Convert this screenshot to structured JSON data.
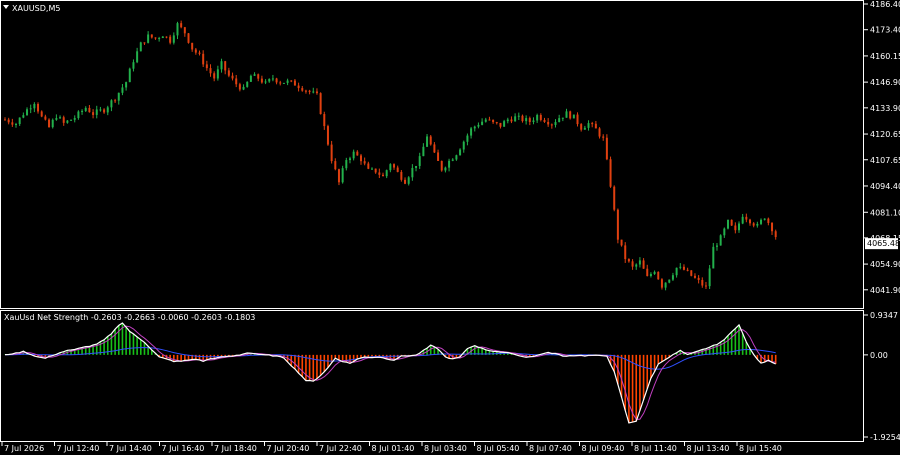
{
  "symbol_header": "XAUUSD,M5",
  "indicator_header": "XauUsd Net Strength -0.2603 -0.2663 -0.0060 -0.2603 -0.1803",
  "current_price": "4065.48",
  "colors": {
    "background": "#000000",
    "frame": "#ffffff",
    "bull": "#22b14c",
    "bear": "#e04010",
    "hist_pos": "#18c018",
    "hist_neg": "#ff4400",
    "line_main": "#ffffff",
    "line_signal": "#c040c0",
    "line_blue": "#3050ff"
  },
  "chart_data": [
    {
      "type": "candlestick",
      "y_axis_ticks": [
        "4186.40",
        "4173.40",
        "4160.15",
        "4146.90",
        "4133.90",
        "4120.65",
        "4107.65",
        "4094.40",
        "4081.10",
        "4068.15",
        "4054.90",
        "4041.90"
      ],
      "y_range": [
        4037.5,
        4186.4
      ],
      "close_path": [
        [
          0,
          4128
        ],
        [
          3,
          4126
        ],
        [
          5,
          4131
        ],
        [
          8,
          4137
        ],
        [
          10,
          4129
        ],
        [
          12,
          4124
        ],
        [
          14,
          4130
        ],
        [
          16,
          4126
        ],
        [
          19,
          4129
        ],
        [
          22,
          4134
        ],
        [
          24,
          4131
        ],
        [
          27,
          4133
        ],
        [
          30,
          4139
        ],
        [
          33,
          4147
        ],
        [
          35,
          4158
        ],
        [
          37,
          4166
        ],
        [
          39,
          4170
        ],
        [
          41,
          4169
        ],
        [
          43,
          4171
        ],
        [
          45,
          4168
        ],
        [
          47,
          4176
        ],
        [
          49,
          4172
        ],
        [
          51,
          4164
        ],
        [
          53,
          4160
        ],
        [
          55,
          4154
        ],
        [
          57,
          4149
        ],
        [
          59,
          4156
        ],
        [
          61,
          4150
        ],
        [
          63,
          4146
        ],
        [
          65,
          4143
        ],
        [
          67,
          4150
        ],
        [
          69,
          4149
        ],
        [
          71,
          4146
        ],
        [
          73,
          4149
        ],
        [
          75,
          4147
        ],
        [
          77,
          4147
        ],
        [
          79,
          4146
        ],
        [
          81,
          4144
        ],
        [
          83,
          4142
        ],
        [
          85,
          4140
        ],
        [
          87,
          4124
        ],
        [
          89,
          4108
        ],
        [
          91,
          4096
        ],
        [
          93,
          4108
        ],
        [
          95,
          4111
        ],
        [
          97,
          4108
        ],
        [
          99,
          4102
        ],
        [
          101,
          4102
        ],
        [
          103,
          4099
        ],
        [
          105,
          4106
        ],
        [
          107,
          4101
        ],
        [
          109,
          4097
        ],
        [
          111,
          4103
        ],
        [
          113,
          4108
        ],
        [
          115,
          4120
        ],
        [
          117,
          4110
        ],
        [
          119,
          4103
        ],
        [
          121,
          4107
        ],
        [
          123,
          4111
        ],
        [
          125,
          4117
        ],
        [
          127,
          4123
        ],
        [
          129,
          4126
        ],
        [
          131,
          4128
        ],
        [
          133,
          4126
        ],
        [
          135,
          4125
        ],
        [
          137,
          4128
        ],
        [
          139,
          4129
        ],
        [
          141,
          4128
        ],
        [
          143,
          4127
        ],
        [
          145,
          4130
        ],
        [
          147,
          4128
        ],
        [
          149,
          4126
        ],
        [
          151,
          4129
        ],
        [
          153,
          4131
        ],
        [
          155,
          4129
        ],
        [
          157,
          4124
        ],
        [
          159,
          4126
        ],
        [
          161,
          4123
        ],
        [
          163,
          4118
        ],
        [
          165,
          4095
        ],
        [
          167,
          4068
        ],
        [
          169,
          4058
        ],
        [
          171,
          4053
        ],
        [
          173,
          4056
        ],
        [
          175,
          4048
        ],
        [
          177,
          4052
        ],
        [
          179,
          4044
        ],
        [
          181,
          4048
        ],
        [
          183,
          4053
        ],
        [
          185,
          4052
        ],
        [
          187,
          4049
        ],
        [
          189,
          4046
        ],
        [
          191,
          4043
        ],
        [
          193,
          4063
        ],
        [
          195,
          4068
        ],
        [
          197,
          4076
        ],
        [
          199,
          4071
        ],
        [
          201,
          4080
        ],
        [
          203,
          4077
        ],
        [
          205,
          4074
        ],
        [
          207,
          4079
        ],
        [
          209,
          4073
        ],
        [
          211,
          4065
        ]
      ],
      "n_bars": 211
    },
    {
      "type": "histogram",
      "y_axis_ticks": [
        "0.9347",
        "0.00",
        "-1.9254"
      ],
      "y_range": [
        -1.9254,
        0.9347
      ],
      "hist_path": [
        [
          0,
          0.0
        ],
        [
          3,
          0.04
        ],
        [
          5,
          0.08
        ],
        [
          7,
          0.01
        ],
        [
          9,
          -0.05
        ],
        [
          11,
          -0.08
        ],
        [
          13,
          -0.01
        ],
        [
          15,
          0.05
        ],
        [
          17,
          0.1
        ],
        [
          19,
          0.12
        ],
        [
          21,
          0.18
        ],
        [
          23,
          0.2
        ],
        [
          25,
          0.25
        ],
        [
          27,
          0.35
        ],
        [
          29,
          0.5
        ],
        [
          31,
          0.7
        ],
        [
          32,
          0.75
        ],
        [
          34,
          0.55
        ],
        [
          36,
          0.42
        ],
        [
          38,
          0.3
        ],
        [
          40,
          0.12
        ],
        [
          42,
          -0.05
        ],
        [
          44,
          -0.1
        ],
        [
          46,
          -0.15
        ],
        [
          48,
          -0.15
        ],
        [
          50,
          -0.12
        ],
        [
          52,
          -0.1
        ],
        [
          54,
          -0.15
        ],
        [
          56,
          -0.09
        ],
        [
          58,
          -0.07
        ],
        [
          60,
          -0.04
        ],
        [
          62,
          -0.03
        ],
        [
          64,
          0.0
        ],
        [
          66,
          0.05
        ],
        [
          68,
          0.03
        ],
        [
          70,
          0.0
        ],
        [
          72,
          -0.01
        ],
        [
          74,
          -0.03
        ],
        [
          76,
          -0.07
        ],
        [
          78,
          -0.25
        ],
        [
          80,
          -0.42
        ],
        [
          82,
          -0.6
        ],
        [
          84,
          -0.62
        ],
        [
          86,
          -0.48
        ],
        [
          88,
          -0.3
        ],
        [
          90,
          -0.08
        ],
        [
          92,
          -0.15
        ],
        [
          94,
          -0.2
        ],
        [
          96,
          -0.1
        ],
        [
          98,
          -0.05
        ],
        [
          100,
          -0.06
        ],
        [
          102,
          -0.05
        ],
        [
          104,
          -0.09
        ],
        [
          106,
          -0.12
        ],
        [
          108,
          -0.03
        ],
        [
          110,
          -0.02
        ],
        [
          112,
          -0.01
        ],
        [
          114,
          0.1
        ],
        [
          116,
          0.22
        ],
        [
          118,
          0.14
        ],
        [
          120,
          -0.05
        ],
        [
          122,
          -0.1
        ],
        [
          124,
          -0.05
        ],
        [
          126,
          0.15
        ],
        [
          128,
          0.22
        ],
        [
          130,
          0.15
        ],
        [
          132,
          0.1
        ],
        [
          134,
          0.08
        ],
        [
          136,
          0.05
        ],
        [
          138,
          0.04
        ],
        [
          140,
          -0.02
        ],
        [
          142,
          -0.05
        ],
        [
          144,
          -0.04
        ],
        [
          146,
          0.02
        ],
        [
          148,
          0.05
        ],
        [
          150,
          0.03
        ],
        [
          152,
          -0.03
        ],
        [
          154,
          -0.02
        ],
        [
          156,
          -0.01
        ],
        [
          158,
          -0.02
        ],
        [
          160,
          -0.01
        ],
        [
          162,
          -0.02
        ],
        [
          164,
          -0.02
        ],
        [
          166,
          -0.4
        ],
        [
          168,
          -1.0
        ],
        [
          170,
          -1.6
        ],
        [
          172,
          -1.55
        ],
        [
          174,
          -1.05
        ],
        [
          176,
          -0.55
        ],
        [
          178,
          -0.22
        ],
        [
          180,
          -0.1
        ],
        [
          182,
          0.0
        ],
        [
          184,
          0.1
        ],
        [
          186,
          0.0
        ],
        [
          188,
          0.06
        ],
        [
          190,
          0.12
        ],
        [
          192,
          0.18
        ],
        [
          194,
          0.25
        ],
        [
          196,
          0.35
        ],
        [
          198,
          0.55
        ],
        [
          200,
          0.7
        ],
        [
          202,
          0.3
        ],
        [
          204,
          0.0
        ],
        [
          206,
          -0.2
        ],
        [
          208,
          -0.12
        ],
        [
          211,
          -0.26
        ]
      ]
    }
  ],
  "x_axis_labels": [
    "7 Jul 2026",
    "7 Jul 12:40",
    "7 Jul 14:40",
    "7 Jul 16:40",
    "7 Jul 18:40",
    "7 Jul 20:40",
    "7 Jul 22:40",
    "8 Jul 01:40",
    "8 Jul 03:40",
    "8 Jul 05:40",
    "8 Jul 07:40",
    "8 Jul 09:40",
    "8 Jul 11:40",
    "8 Jul 13:40",
    "8 Jul 15:40"
  ]
}
